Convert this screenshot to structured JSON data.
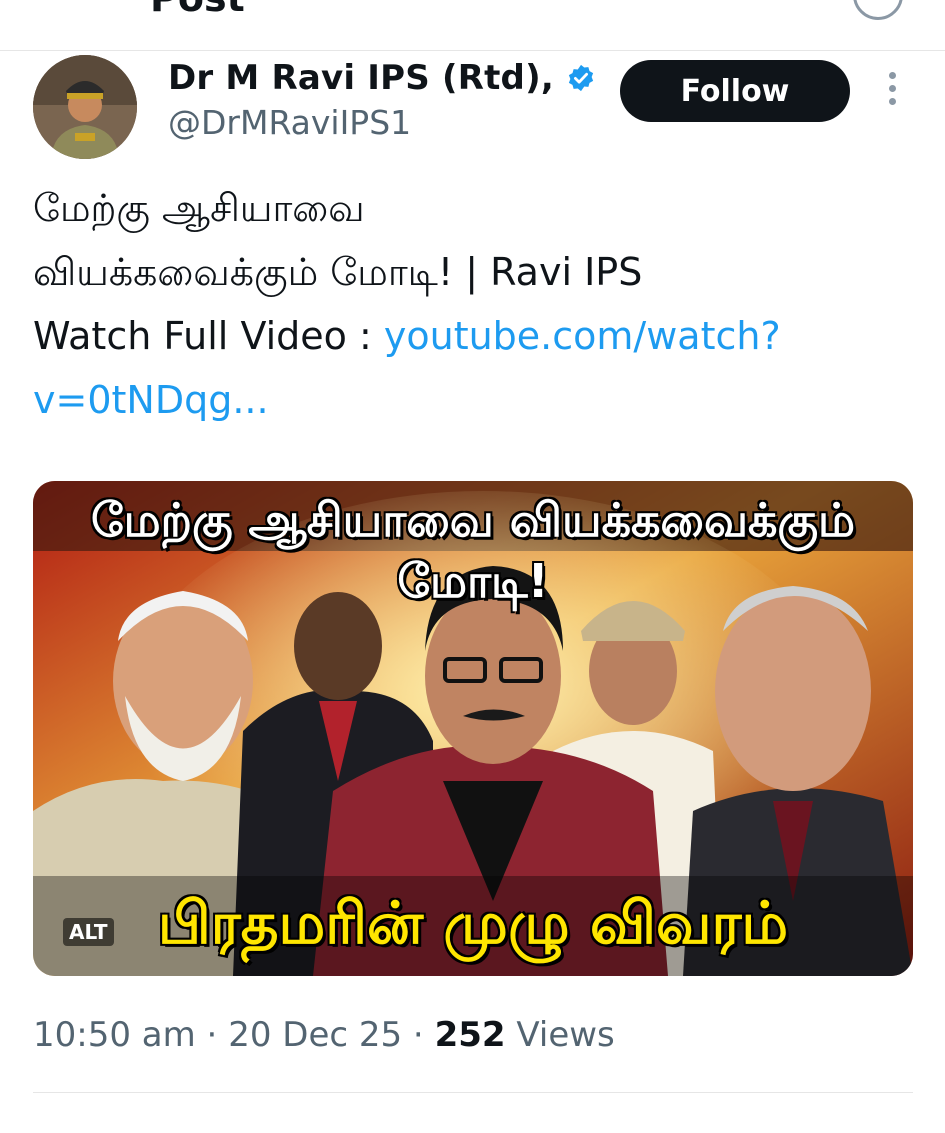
{
  "header": {
    "title": "Post"
  },
  "author": {
    "name": "Dr M Ravi IPS (Rtd),",
    "handle": "@DrMRaviIPS1",
    "verified": true,
    "follow_label": "Follow"
  },
  "tweet": {
    "line1": "மேற்கு ஆசியாவை",
    "line2": "வியக்கவைக்கும் மோடி! | Ravi IPS",
    "line3_prefix": "Watch Full Video : ",
    "link_part1": "youtube.com/watch?",
    "link_part2": "v=0tNDqg..."
  },
  "media": {
    "headline": "மேற்கு ஆசியாவை வியக்கவைக்கும் மோடி!",
    "caption": "பிரதமரின் முழு விவரம்",
    "alt_label": "ALT"
  },
  "meta": {
    "time": "10:50 am",
    "sep1": " · ",
    "date": "20 Dec 25",
    "sep2": " · ",
    "views_count": "252",
    "views_label": " Views"
  },
  "colors": {
    "link": "#1d9bf0",
    "verified": "#1d9bf0",
    "follow_bg": "#0f1419",
    "caption": "#ffe600"
  },
  "icons": [
    "verified-badge-icon",
    "more-options-icon"
  ]
}
